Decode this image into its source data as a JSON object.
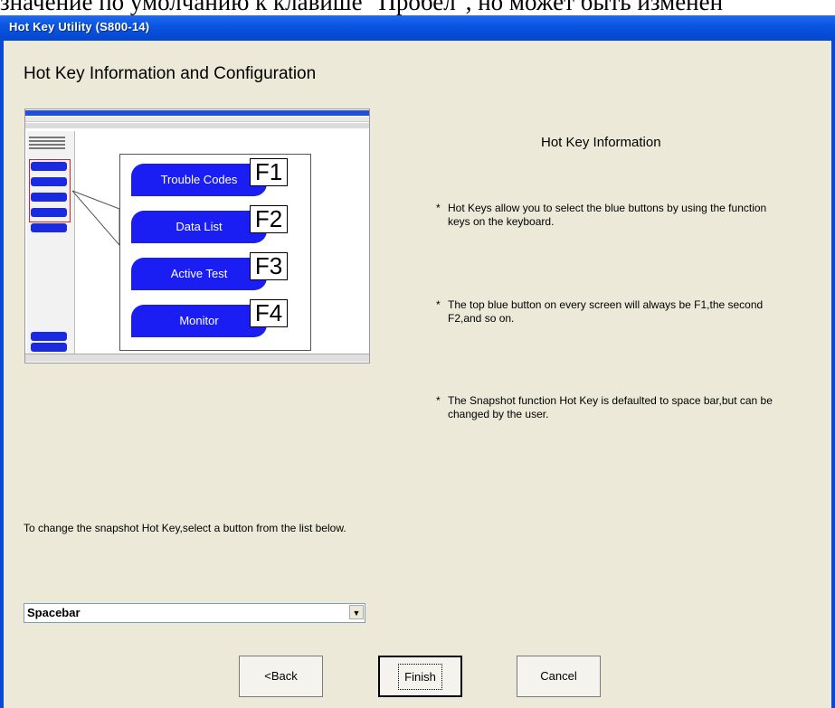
{
  "caption": "значение по умолчанию к клавише \"Пробел\", но может быть изменен",
  "window": {
    "title": "Hot Key Utility (S800-14)"
  },
  "heading": "Hot Key Information and Configuration",
  "preview": {
    "buttons": [
      {
        "label": "Trouble Codes",
        "key": "F1"
      },
      {
        "label": "Data List",
        "key": "F2"
      },
      {
        "label": "Active Test",
        "key": "F3"
      },
      {
        "label": "Monitor",
        "key": "F4"
      }
    ]
  },
  "info": {
    "title": "Hot Key Information",
    "bullets": [
      "Hot Keys allow you to select the blue buttons by using the function keys on the keyboard.",
      "The top blue button on every screen will always be F1,the second F2,and so on.",
      "The Snapshot function Hot Key is defaulted to space bar,but can be changed by the user."
    ]
  },
  "instruction": "To change the snapshot Hot Key,select a button from the list below.",
  "hotkey_select": {
    "value": "Spacebar"
  },
  "buttons": {
    "back": "<Back",
    "finish": "Finish",
    "cancel": "Cancel"
  },
  "colors": {
    "titlebar": "#0a55e2",
    "client": "#ece9d8",
    "blue_button": "#1a1ef2"
  },
  "icons": {
    "dropdown": "chevron-down-icon"
  }
}
